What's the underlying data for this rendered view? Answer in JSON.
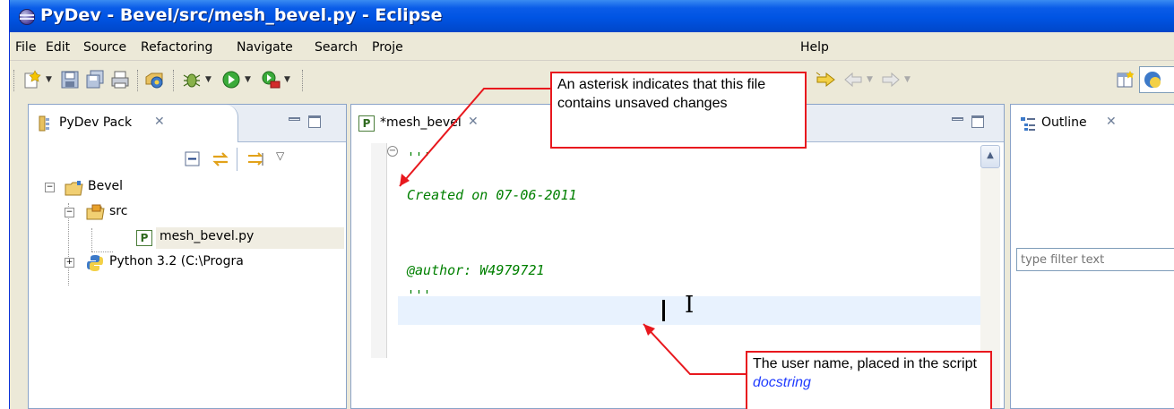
{
  "window": {
    "title": "PyDev - Bevel/src/mesh_bevel.py - Eclipse"
  },
  "menu": [
    "File",
    "Edit",
    "Source",
    "Refactoring",
    "Navigate",
    "Search",
    "Proje",
    "Help"
  ],
  "package_explorer": {
    "tab_label": "PyDev Pack",
    "tree": {
      "project": "Bevel",
      "src_folder": "src",
      "file": "mesh_bevel.py",
      "interpreter": "Python 3.2  (C:\\Progra"
    }
  },
  "editor": {
    "tab_label": "*mesh_bevel",
    "code_lines": [
      "'''",
      "Created on 07-06-2011",
      "",
      "@author: W4979721",
      "'''"
    ]
  },
  "outline": {
    "tab_label": "Outline",
    "filter_placeholder": "type filter text"
  },
  "callouts": {
    "asterisk": "An asterisk indicates that this file contains unsaved changes",
    "user_name_prefix": "The user name, placed in the script",
    "user_name_term": "docstring"
  },
  "colors": {
    "titlebar": "#0054e3",
    "callout_border": "#e8181e",
    "code_green": "#008000",
    "highlight_line": "#e8f2fe",
    "docstring_link": "#1f3bff"
  }
}
